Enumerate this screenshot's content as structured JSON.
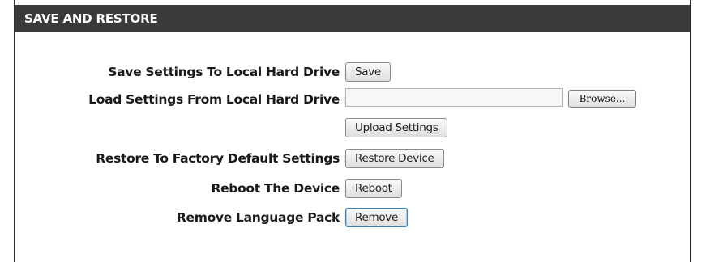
{
  "panel": {
    "title": "SAVE AND RESTORE"
  },
  "rows": {
    "save": {
      "label": "Save Settings To Local Hard Drive :",
      "button": "Save"
    },
    "load": {
      "label": "Load Settings From Local Hard Drive :",
      "file_value": "",
      "browse": "Browse..."
    },
    "upload": {
      "button": "Upload Settings"
    },
    "restore": {
      "label": "Restore To Factory Default Settings :",
      "button": "Restore Device"
    },
    "reboot": {
      "label": "Reboot The Device :",
      "button": "Reboot"
    },
    "language": {
      "label": "Remove Language Pack :",
      "button": "Remove"
    }
  },
  "colors": {
    "header_bg": "#3a3a3a",
    "header_text": "#ffffff",
    "focus_border": "#3c7fb1"
  }
}
